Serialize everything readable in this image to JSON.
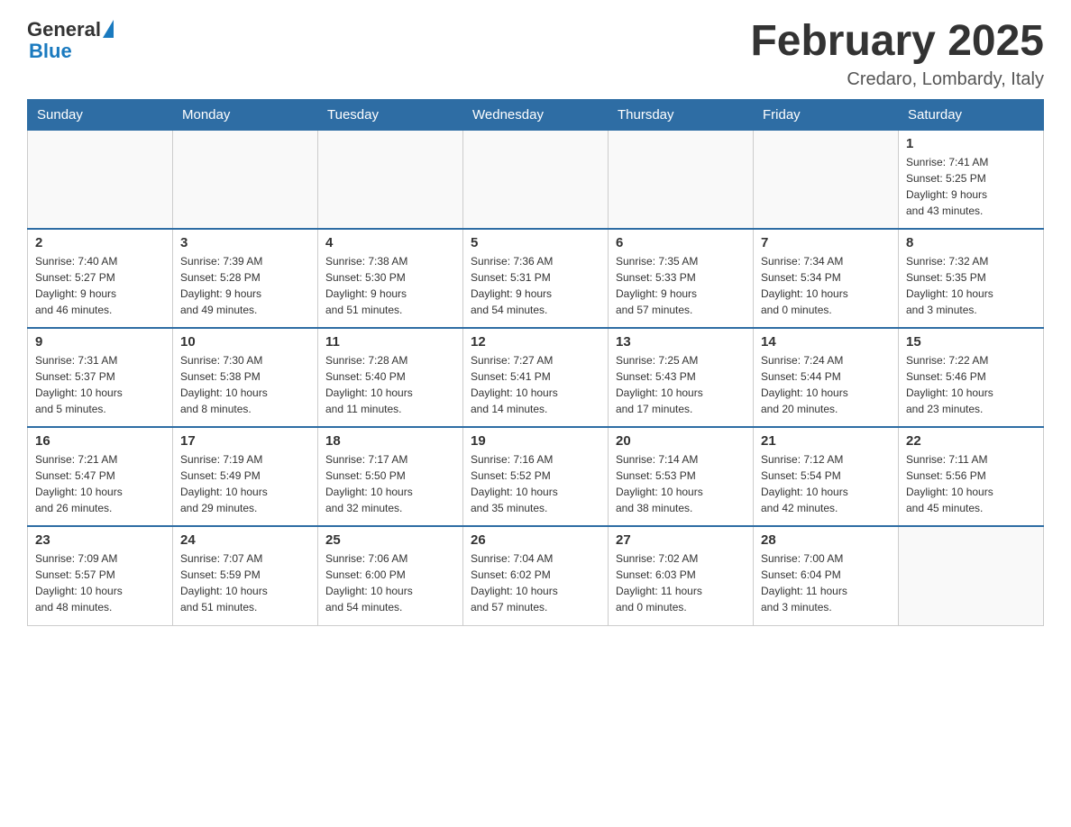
{
  "header": {
    "logo": {
      "general": "General",
      "blue": "Blue"
    },
    "title": "February 2025",
    "subtitle": "Credaro, Lombardy, Italy"
  },
  "days_of_week": [
    "Sunday",
    "Monday",
    "Tuesday",
    "Wednesday",
    "Thursday",
    "Friday",
    "Saturday"
  ],
  "weeks": [
    {
      "days": [
        {
          "date": "",
          "info": ""
        },
        {
          "date": "",
          "info": ""
        },
        {
          "date": "",
          "info": ""
        },
        {
          "date": "",
          "info": ""
        },
        {
          "date": "",
          "info": ""
        },
        {
          "date": "",
          "info": ""
        },
        {
          "date": "1",
          "info": "Sunrise: 7:41 AM\nSunset: 5:25 PM\nDaylight: 9 hours\nand 43 minutes."
        }
      ]
    },
    {
      "days": [
        {
          "date": "2",
          "info": "Sunrise: 7:40 AM\nSunset: 5:27 PM\nDaylight: 9 hours\nand 46 minutes."
        },
        {
          "date": "3",
          "info": "Sunrise: 7:39 AM\nSunset: 5:28 PM\nDaylight: 9 hours\nand 49 minutes."
        },
        {
          "date": "4",
          "info": "Sunrise: 7:38 AM\nSunset: 5:30 PM\nDaylight: 9 hours\nand 51 minutes."
        },
        {
          "date": "5",
          "info": "Sunrise: 7:36 AM\nSunset: 5:31 PM\nDaylight: 9 hours\nand 54 minutes."
        },
        {
          "date": "6",
          "info": "Sunrise: 7:35 AM\nSunset: 5:33 PM\nDaylight: 9 hours\nand 57 minutes."
        },
        {
          "date": "7",
          "info": "Sunrise: 7:34 AM\nSunset: 5:34 PM\nDaylight: 10 hours\nand 0 minutes."
        },
        {
          "date": "8",
          "info": "Sunrise: 7:32 AM\nSunset: 5:35 PM\nDaylight: 10 hours\nand 3 minutes."
        }
      ]
    },
    {
      "days": [
        {
          "date": "9",
          "info": "Sunrise: 7:31 AM\nSunset: 5:37 PM\nDaylight: 10 hours\nand 5 minutes."
        },
        {
          "date": "10",
          "info": "Sunrise: 7:30 AM\nSunset: 5:38 PM\nDaylight: 10 hours\nand 8 minutes."
        },
        {
          "date": "11",
          "info": "Sunrise: 7:28 AM\nSunset: 5:40 PM\nDaylight: 10 hours\nand 11 minutes."
        },
        {
          "date": "12",
          "info": "Sunrise: 7:27 AM\nSunset: 5:41 PM\nDaylight: 10 hours\nand 14 minutes."
        },
        {
          "date": "13",
          "info": "Sunrise: 7:25 AM\nSunset: 5:43 PM\nDaylight: 10 hours\nand 17 minutes."
        },
        {
          "date": "14",
          "info": "Sunrise: 7:24 AM\nSunset: 5:44 PM\nDaylight: 10 hours\nand 20 minutes."
        },
        {
          "date": "15",
          "info": "Sunrise: 7:22 AM\nSunset: 5:46 PM\nDaylight: 10 hours\nand 23 minutes."
        }
      ]
    },
    {
      "days": [
        {
          "date": "16",
          "info": "Sunrise: 7:21 AM\nSunset: 5:47 PM\nDaylight: 10 hours\nand 26 minutes."
        },
        {
          "date": "17",
          "info": "Sunrise: 7:19 AM\nSunset: 5:49 PM\nDaylight: 10 hours\nand 29 minutes."
        },
        {
          "date": "18",
          "info": "Sunrise: 7:17 AM\nSunset: 5:50 PM\nDaylight: 10 hours\nand 32 minutes."
        },
        {
          "date": "19",
          "info": "Sunrise: 7:16 AM\nSunset: 5:52 PM\nDaylight: 10 hours\nand 35 minutes."
        },
        {
          "date": "20",
          "info": "Sunrise: 7:14 AM\nSunset: 5:53 PM\nDaylight: 10 hours\nand 38 minutes."
        },
        {
          "date": "21",
          "info": "Sunrise: 7:12 AM\nSunset: 5:54 PM\nDaylight: 10 hours\nand 42 minutes."
        },
        {
          "date": "22",
          "info": "Sunrise: 7:11 AM\nSunset: 5:56 PM\nDaylight: 10 hours\nand 45 minutes."
        }
      ]
    },
    {
      "days": [
        {
          "date": "23",
          "info": "Sunrise: 7:09 AM\nSunset: 5:57 PM\nDaylight: 10 hours\nand 48 minutes."
        },
        {
          "date": "24",
          "info": "Sunrise: 7:07 AM\nSunset: 5:59 PM\nDaylight: 10 hours\nand 51 minutes."
        },
        {
          "date": "25",
          "info": "Sunrise: 7:06 AM\nSunset: 6:00 PM\nDaylight: 10 hours\nand 54 minutes."
        },
        {
          "date": "26",
          "info": "Sunrise: 7:04 AM\nSunset: 6:02 PM\nDaylight: 10 hours\nand 57 minutes."
        },
        {
          "date": "27",
          "info": "Sunrise: 7:02 AM\nSunset: 6:03 PM\nDaylight: 11 hours\nand 0 minutes."
        },
        {
          "date": "28",
          "info": "Sunrise: 7:00 AM\nSunset: 6:04 PM\nDaylight: 11 hours\nand 3 minutes."
        },
        {
          "date": "",
          "info": ""
        }
      ]
    }
  ]
}
